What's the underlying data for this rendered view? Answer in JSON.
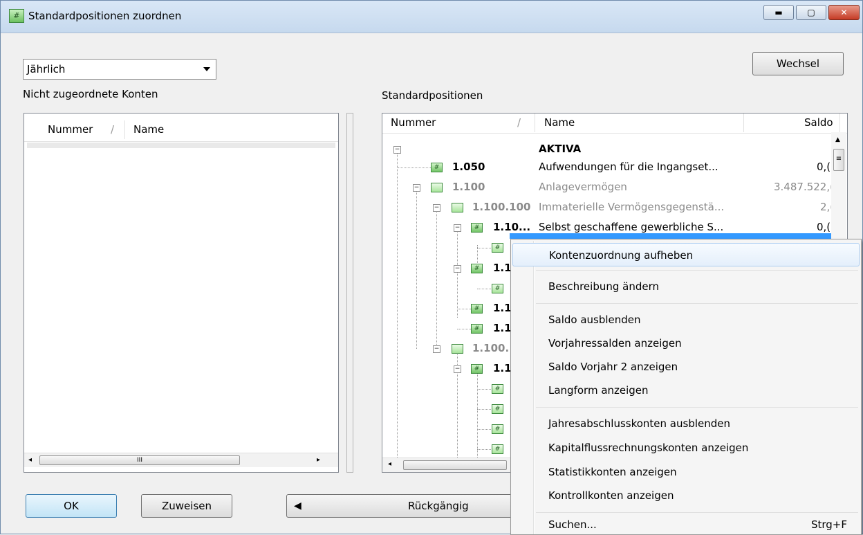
{
  "window": {
    "title": "Standardpositionen zuordnen",
    "min_glyph": "▬",
    "max_glyph": "▢",
    "close_glyph": "✕"
  },
  "period": {
    "selected": "Jährlich"
  },
  "buttons": {
    "wechsel": "Wechsel",
    "ok": "OK",
    "zuweisen": "Zuweisen",
    "rueckgaengig": "Rückgängig"
  },
  "left_panel": {
    "title": "Nicht zugeordnete Konten",
    "col_nummer": "Nummer",
    "col_name": "Name",
    "sort_glyph": "/"
  },
  "right_panel": {
    "title": "Standardpositionen",
    "col_nummer": "Nummer",
    "col_name": "Name",
    "col_saldo": "Saldo",
    "sort_glyph": "/"
  },
  "tree_rows": [
    {
      "nummer": "",
      "name": "AKTIVA",
      "saldo": ""
    },
    {
      "nummer": "1.050",
      "name": "Aufwendungen für die Ingangset...",
      "saldo": "0,("
    },
    {
      "nummer": "1.100",
      "name": "Anlagevermögen",
      "saldo": "3.487.522,("
    },
    {
      "nummer": "1.100.100",
      "name": "Immaterielle Vermögensgegenstä...",
      "saldo": "2,("
    },
    {
      "nummer": "1.10...",
      "name": "Selbst geschaffene gewerbliche S...",
      "saldo": "0,("
    },
    {
      "nummer": "1.1",
      "name": "",
      "saldo": ""
    },
    {
      "nummer": "1.1",
      "name": "",
      "saldo": ""
    },
    {
      "nummer": "1.1",
      "name": "",
      "saldo": ""
    },
    {
      "nummer": "1.100.",
      "name": "",
      "saldo": ""
    },
    {
      "nummer": "1.1",
      "name": "",
      "saldo": ""
    }
  ],
  "context_menu": {
    "items": [
      "Kontenzuordnung aufheben",
      "Beschreibung ändern",
      "Saldo ausblenden",
      "Vorjahressalden anzeigen",
      "Saldo Vorjahr 2 anzeigen",
      "Langform anzeigen",
      "Jahresabschlusskonten ausblenden",
      "Kapitalflussrechnungskonten anzeigen",
      "Statistikkonten anzeigen",
      "Kontrollkonten anzeigen",
      "Suchen..."
    ],
    "shortcut_suchen": "Strg+F"
  }
}
